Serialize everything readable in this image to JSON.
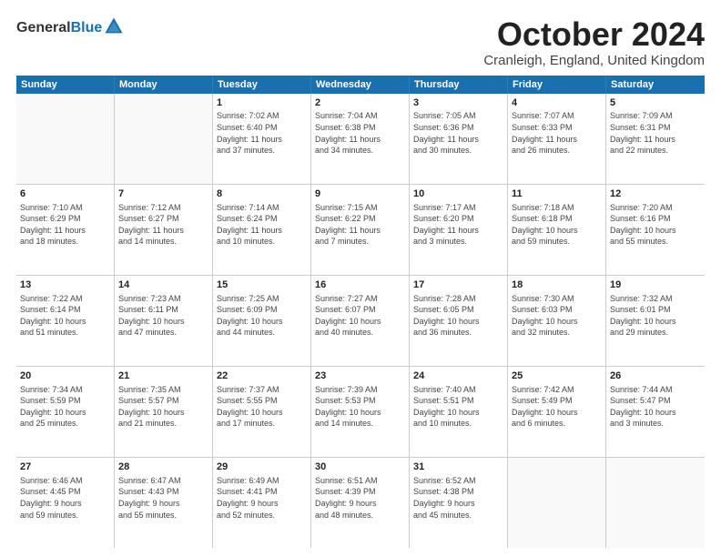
{
  "logo": {
    "general": "General",
    "blue": "Blue"
  },
  "header": {
    "month": "October 2024",
    "location": "Cranleigh, England, United Kingdom"
  },
  "days_of_week": [
    "Sunday",
    "Monday",
    "Tuesday",
    "Wednesday",
    "Thursday",
    "Friday",
    "Saturday"
  ],
  "weeks": [
    [
      {
        "day": "",
        "text": "",
        "empty": true
      },
      {
        "day": "",
        "text": "",
        "empty": true
      },
      {
        "day": "1",
        "text": "Sunrise: 7:02 AM\nSunset: 6:40 PM\nDaylight: 11 hours\nand 37 minutes."
      },
      {
        "day": "2",
        "text": "Sunrise: 7:04 AM\nSunset: 6:38 PM\nDaylight: 11 hours\nand 34 minutes."
      },
      {
        "day": "3",
        "text": "Sunrise: 7:05 AM\nSunset: 6:36 PM\nDaylight: 11 hours\nand 30 minutes."
      },
      {
        "day": "4",
        "text": "Sunrise: 7:07 AM\nSunset: 6:33 PM\nDaylight: 11 hours\nand 26 minutes."
      },
      {
        "day": "5",
        "text": "Sunrise: 7:09 AM\nSunset: 6:31 PM\nDaylight: 11 hours\nand 22 minutes."
      }
    ],
    [
      {
        "day": "6",
        "text": "Sunrise: 7:10 AM\nSunset: 6:29 PM\nDaylight: 11 hours\nand 18 minutes."
      },
      {
        "day": "7",
        "text": "Sunrise: 7:12 AM\nSunset: 6:27 PM\nDaylight: 11 hours\nand 14 minutes."
      },
      {
        "day": "8",
        "text": "Sunrise: 7:14 AM\nSunset: 6:24 PM\nDaylight: 11 hours\nand 10 minutes."
      },
      {
        "day": "9",
        "text": "Sunrise: 7:15 AM\nSunset: 6:22 PM\nDaylight: 11 hours\nand 7 minutes."
      },
      {
        "day": "10",
        "text": "Sunrise: 7:17 AM\nSunset: 6:20 PM\nDaylight: 11 hours\nand 3 minutes."
      },
      {
        "day": "11",
        "text": "Sunrise: 7:18 AM\nSunset: 6:18 PM\nDaylight: 10 hours\nand 59 minutes."
      },
      {
        "day": "12",
        "text": "Sunrise: 7:20 AM\nSunset: 6:16 PM\nDaylight: 10 hours\nand 55 minutes."
      }
    ],
    [
      {
        "day": "13",
        "text": "Sunrise: 7:22 AM\nSunset: 6:14 PM\nDaylight: 10 hours\nand 51 minutes."
      },
      {
        "day": "14",
        "text": "Sunrise: 7:23 AM\nSunset: 6:11 PM\nDaylight: 10 hours\nand 47 minutes."
      },
      {
        "day": "15",
        "text": "Sunrise: 7:25 AM\nSunset: 6:09 PM\nDaylight: 10 hours\nand 44 minutes."
      },
      {
        "day": "16",
        "text": "Sunrise: 7:27 AM\nSunset: 6:07 PM\nDaylight: 10 hours\nand 40 minutes."
      },
      {
        "day": "17",
        "text": "Sunrise: 7:28 AM\nSunset: 6:05 PM\nDaylight: 10 hours\nand 36 minutes."
      },
      {
        "day": "18",
        "text": "Sunrise: 7:30 AM\nSunset: 6:03 PM\nDaylight: 10 hours\nand 32 minutes."
      },
      {
        "day": "19",
        "text": "Sunrise: 7:32 AM\nSunset: 6:01 PM\nDaylight: 10 hours\nand 29 minutes."
      }
    ],
    [
      {
        "day": "20",
        "text": "Sunrise: 7:34 AM\nSunset: 5:59 PM\nDaylight: 10 hours\nand 25 minutes."
      },
      {
        "day": "21",
        "text": "Sunrise: 7:35 AM\nSunset: 5:57 PM\nDaylight: 10 hours\nand 21 minutes."
      },
      {
        "day": "22",
        "text": "Sunrise: 7:37 AM\nSunset: 5:55 PM\nDaylight: 10 hours\nand 17 minutes."
      },
      {
        "day": "23",
        "text": "Sunrise: 7:39 AM\nSunset: 5:53 PM\nDaylight: 10 hours\nand 14 minutes."
      },
      {
        "day": "24",
        "text": "Sunrise: 7:40 AM\nSunset: 5:51 PM\nDaylight: 10 hours\nand 10 minutes."
      },
      {
        "day": "25",
        "text": "Sunrise: 7:42 AM\nSunset: 5:49 PM\nDaylight: 10 hours\nand 6 minutes."
      },
      {
        "day": "26",
        "text": "Sunrise: 7:44 AM\nSunset: 5:47 PM\nDaylight: 10 hours\nand 3 minutes."
      }
    ],
    [
      {
        "day": "27",
        "text": "Sunrise: 6:46 AM\nSunset: 4:45 PM\nDaylight: 9 hours\nand 59 minutes."
      },
      {
        "day": "28",
        "text": "Sunrise: 6:47 AM\nSunset: 4:43 PM\nDaylight: 9 hours\nand 55 minutes."
      },
      {
        "day": "29",
        "text": "Sunrise: 6:49 AM\nSunset: 4:41 PM\nDaylight: 9 hours\nand 52 minutes."
      },
      {
        "day": "30",
        "text": "Sunrise: 6:51 AM\nSunset: 4:39 PM\nDaylight: 9 hours\nand 48 minutes."
      },
      {
        "day": "31",
        "text": "Sunrise: 6:52 AM\nSunset: 4:38 PM\nDaylight: 9 hours\nand 45 minutes."
      },
      {
        "day": "",
        "text": "",
        "empty": true
      },
      {
        "day": "",
        "text": "",
        "empty": true
      }
    ]
  ]
}
